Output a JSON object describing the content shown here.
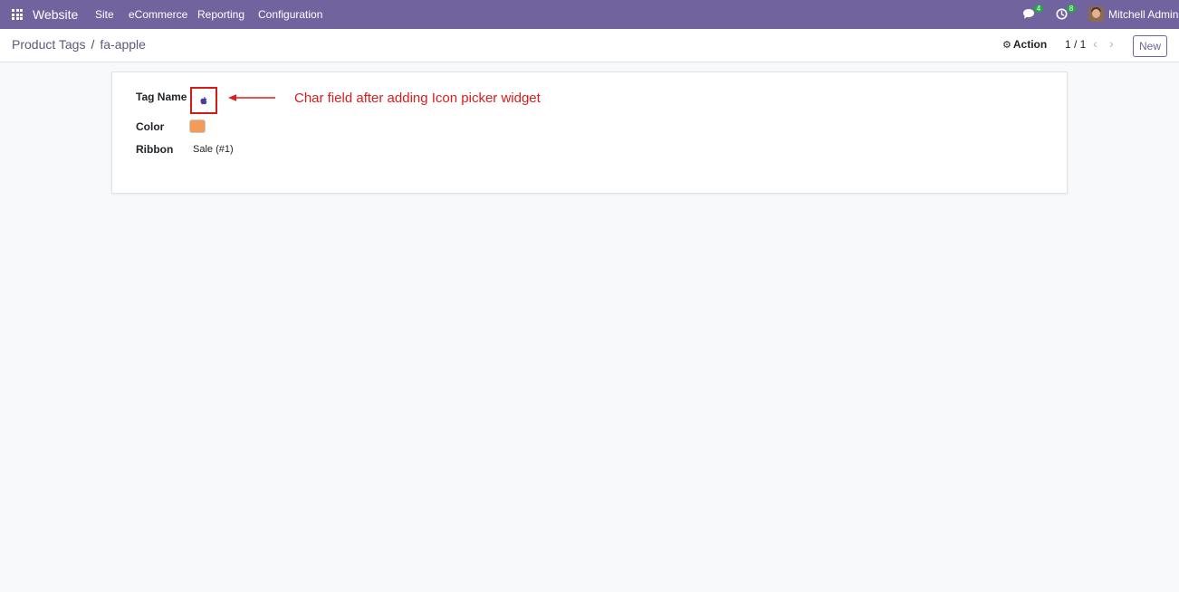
{
  "navbar": {
    "app_name": "Website",
    "menu": [
      "Site",
      "eCommerce",
      "Reporting",
      "Configuration"
    ],
    "messages_icon": "chat-icon",
    "messages_count": "4",
    "activities_icon": "clock-icon",
    "activities_count": "8",
    "user_name": "Mitchell Admin",
    "accent_color": "#71639e"
  },
  "control_panel": {
    "breadcrumb_parent": "Product Tags",
    "breadcrumb_separator": "/",
    "breadcrumb_current": "fa-apple",
    "action_label": "Action",
    "action_icon": "gear-icon",
    "pager_value": "1 / 1",
    "prev_icon": "chevron-left-icon",
    "next_icon": "chevron-right-icon",
    "new_label": "New"
  },
  "form": {
    "tag_name_label": "Tag Name",
    "tag_name_icon": "apple-icon",
    "color_label": "Color",
    "color_value": "#f39c5a",
    "ribbon_label": "Ribbon",
    "ribbon_value": "Sale (#1)"
  },
  "annotation": {
    "text": "Char field after adding Icon picker widget",
    "color": "#e01b1b"
  }
}
